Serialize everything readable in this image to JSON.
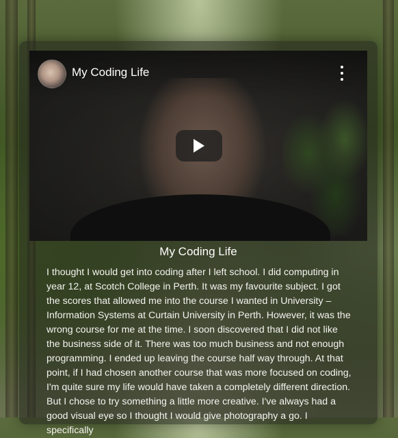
{
  "video": {
    "title": "My Coding Life",
    "play_icon": "play-icon",
    "menu_icon": "kebab-menu-icon"
  },
  "post": {
    "title": "My Coding Life",
    "body": "I thought I would get into coding after I left school. I did computing in year 12, at Scotch College in Perth. It was my favourite subject. I got the scores that allowed me into the course I wanted in University – Information Systems at Curtain University in Perth. However, it was the wrong course for me at the time. I soon discovered that I did not like the business side of it. There was too much business and not enough programming. I ended up leaving the course half way through. At that point, if I had chosen another course that was more focused on coding, I'm quite sure my life would have taken a completely different direction. But I chose to try something a little more creative. I've always had a good visual eye so I thought I would give photography a go. I specifically"
  }
}
